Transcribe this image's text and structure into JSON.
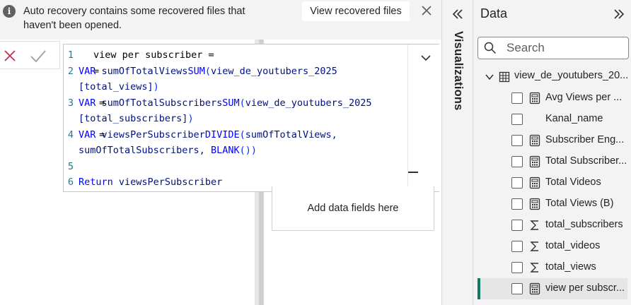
{
  "notification": {
    "message": "Auto recovery contains some recovered files that haven't been opened.",
    "view_button": "View recovered files"
  },
  "editor": {
    "lines": [
      {
        "num": "1",
        "parts": [
          {
            "t": "view per subscriber =",
            "c": "code"
          }
        ]
      },
      {
        "num": "2",
        "parts": [
          {
            "t": "VAR ",
            "c": "kw"
          },
          {
            "t": "sumOfTotalViews",
            "c": "tb"
          },
          {
            "t": "=",
            "c": "code"
          },
          {
            "t": "SUM",
            "c": "kw"
          },
          {
            "t": "(",
            "c": "pn"
          },
          {
            "t": "view_de_youtubers_2025",
            "c": "tb"
          }
        ]
      },
      {
        "num": "",
        "parts": [
          {
            "t": "[total_views]",
            "c": "tb"
          },
          {
            "t": ")",
            "c": "pn"
          }
        ]
      },
      {
        "num": "3",
        "parts": [
          {
            "t": "VAR ",
            "c": "kw"
          },
          {
            "t": "sumOfTotalSubscribers",
            "c": "tb"
          },
          {
            "t": " = ",
            "c": "code"
          },
          {
            "t": "SUM",
            "c": "kw"
          },
          {
            "t": "(",
            "c": "pn"
          },
          {
            "t": "view_de_youtubers_2025",
            "c": "tb"
          }
        ]
      },
      {
        "num": "",
        "parts": [
          {
            "t": "[total_subscribers]",
            "c": "tb"
          },
          {
            "t": ")",
            "c": "pn"
          }
        ]
      },
      {
        "num": "4",
        "parts": [
          {
            "t": "VAR ",
            "c": "kw"
          },
          {
            "t": "viewsPerSubscriber",
            "c": "tb"
          },
          {
            "t": " = ",
            "c": "code"
          },
          {
            "t": "DIVIDE",
            "c": "kw"
          },
          {
            "t": "(",
            "c": "pn"
          },
          {
            "t": "sumOfTotalViews,",
            "c": "tb"
          }
        ]
      },
      {
        "num": "",
        "parts": [
          {
            "t": "sumOfTotalSubscribers, ",
            "c": "tb"
          },
          {
            "t": "BLANK",
            "c": "kw"
          },
          {
            "t": "()",
            "c": "pn"
          },
          {
            "t": ")",
            "c": "pn"
          }
        ]
      },
      {
        "num": "5",
        "parts": []
      },
      {
        "num": "6",
        "parts": [
          {
            "t": "Return ",
            "c": "kw"
          },
          {
            "t": "viewsPerSubscriber",
            "c": "tb"
          }
        ]
      }
    ]
  },
  "canvas": {
    "add_data_fields": "Add data fields here"
  },
  "visualizations": {
    "label": "Visualizations"
  },
  "data_pane": {
    "title": "Data",
    "search_placeholder": "Search",
    "table_name": "view_de_youtubers_20...",
    "fields": [
      {
        "label": "Avg Views per ...",
        "icon": "calculator-icon",
        "selected": false
      },
      {
        "label": "Kanal_name",
        "icon": "",
        "selected": false
      },
      {
        "label": "Subscriber Eng...",
        "icon": "calculator-icon",
        "selected": false
      },
      {
        "label": "Total Subscriber...",
        "icon": "calculator-icon",
        "selected": false
      },
      {
        "label": "Total Videos",
        "icon": "calculator-icon",
        "selected": false
      },
      {
        "label": "Total Views (B)",
        "icon": "calculator-icon",
        "selected": false
      },
      {
        "label": "total_subscribers",
        "icon": "sigma-icon",
        "selected": false
      },
      {
        "label": "total_videos",
        "icon": "sigma-icon",
        "selected": false
      },
      {
        "label": "total_views",
        "icon": "sigma-icon",
        "selected": false
      },
      {
        "label": "view per subscr...",
        "icon": "calculator-icon",
        "selected": true
      }
    ]
  },
  "colors": {
    "accent": "#117865",
    "keyword": "#0000ff",
    "identifier": "#001080"
  }
}
